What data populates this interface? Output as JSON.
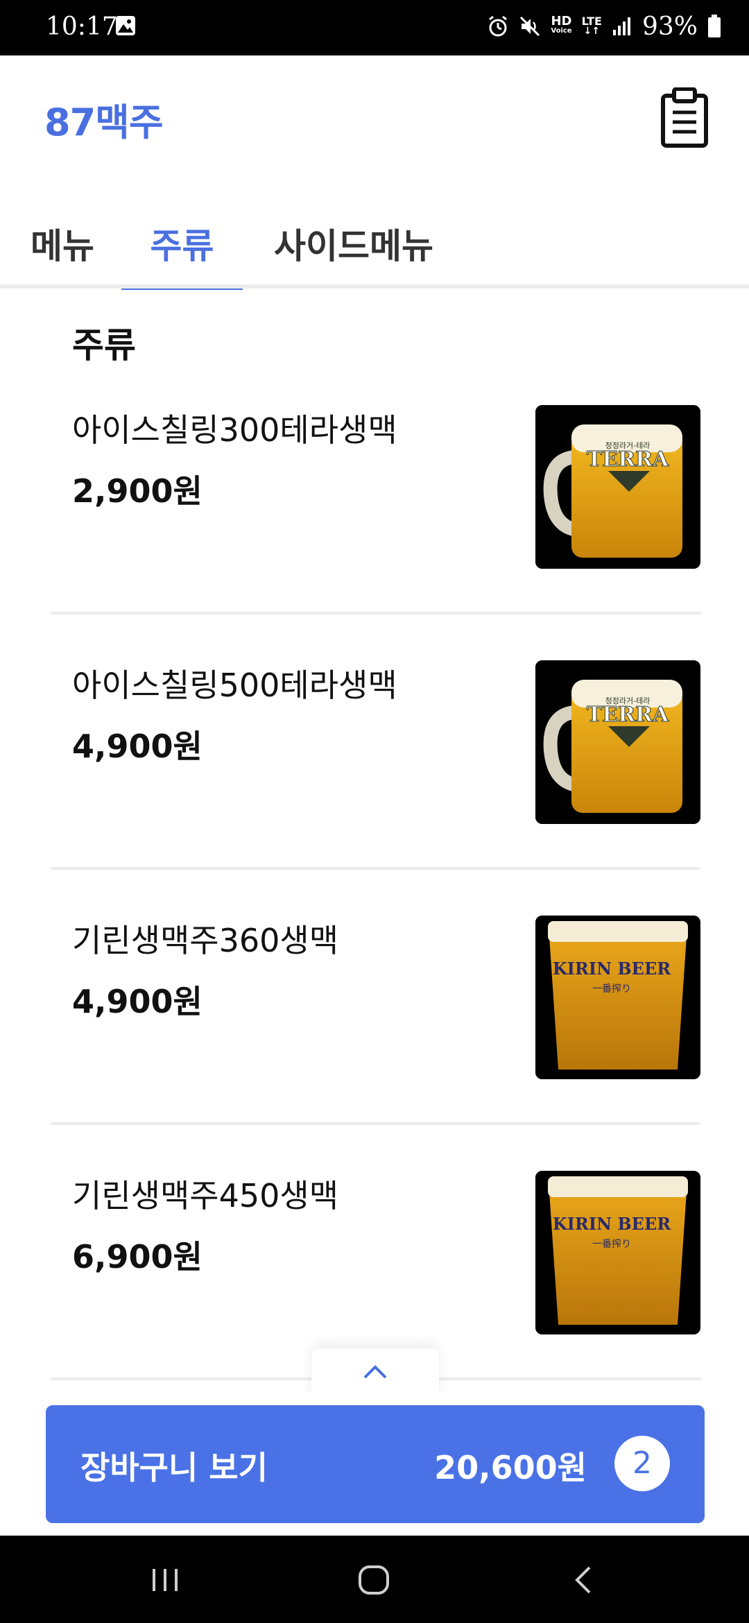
{
  "status_bar": {
    "time": "10:17",
    "battery_percent": "93%",
    "hd_label": "HD",
    "voice_label": "Voice",
    "lte_label": "LTE"
  },
  "header": {
    "title": "87맥주"
  },
  "tabs": [
    {
      "label": "메뉴",
      "active": false
    },
    {
      "label": "주류",
      "active": true
    },
    {
      "label": "사이드메뉴",
      "active": false
    }
  ],
  "section": {
    "title": "주류"
  },
  "items": [
    {
      "name": "아이스칠링300테라생맥",
      "price": "2,900원",
      "image_label": "TERRA",
      "image_sub": "청정라거-테라"
    },
    {
      "name": "아이스칠링500테라생맥",
      "price": "4,900원",
      "image_label": "TERRA",
      "image_sub": "청정라거-테라"
    },
    {
      "name": "기린생맥주360생맥",
      "price": "4,900원",
      "image_label": "KIRIN BEER",
      "image_sub": "一番搾り"
    },
    {
      "name": "기린생맥주450생맥",
      "price": "6,900원",
      "image_label": "KIRIN BEER",
      "image_sub": "一番搾り"
    }
  ],
  "cart": {
    "label": "장바구니 보기",
    "total": "20,600원",
    "count": "2"
  },
  "colors": {
    "accent": "#4a6fe0",
    "cart_button": "#4a72e6"
  }
}
